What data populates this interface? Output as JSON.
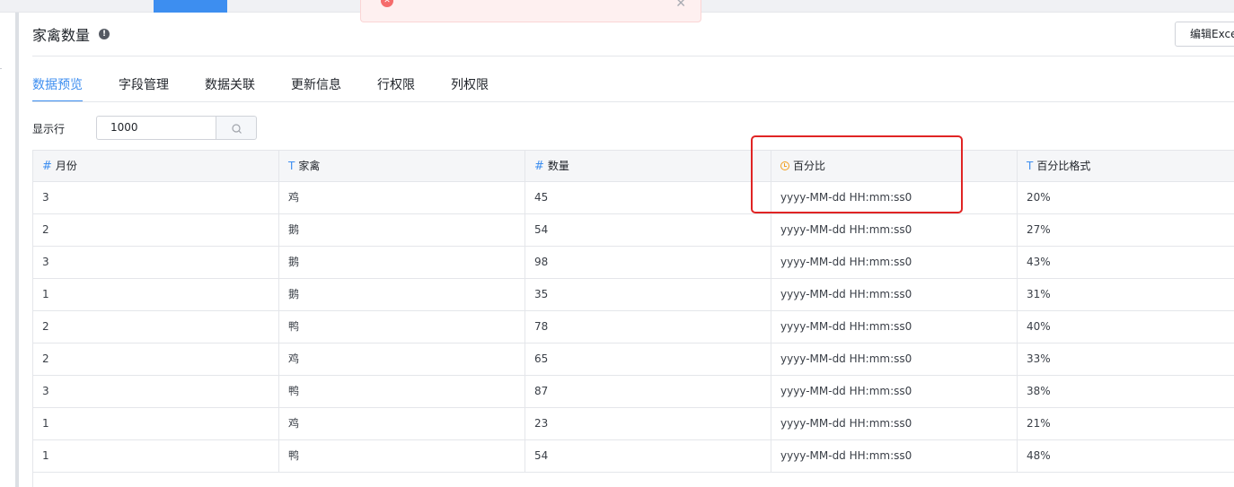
{
  "toast": {
    "error_icon": "error-circle-icon",
    "close_icon": "close-icon"
  },
  "title": "家禽数量",
  "info_icon": "info-icon",
  "actions": {
    "edit_excel": "编辑Excel"
  },
  "tabs": [
    {
      "label": "数据预览",
      "active": true
    },
    {
      "label": "字段管理",
      "active": false
    },
    {
      "label": "数据关联",
      "active": false
    },
    {
      "label": "更新信息",
      "active": false
    },
    {
      "label": "行权限",
      "active": false
    },
    {
      "label": "列权限",
      "active": false
    }
  ],
  "rows_control": {
    "label": "显示行",
    "value": "1000",
    "search_icon": "search-icon"
  },
  "colors": {
    "accent": "#3d8ef0",
    "highlight": "#e02424",
    "date_type": "#f0a020"
  },
  "table": {
    "columns": [
      {
        "type": "number",
        "type_glyph": "#",
        "name": "月份"
      },
      {
        "type": "text",
        "type_glyph": "T",
        "name": "家禽"
      },
      {
        "type": "number",
        "type_glyph": "#",
        "name": "数量"
      },
      {
        "type": "date",
        "type_glyph": "clock",
        "name": "百分比"
      },
      {
        "type": "text",
        "type_glyph": "T",
        "name": "百分比格式"
      }
    ],
    "rows": [
      [
        "3",
        "鸡",
        "45",
        "yyyy-MM-dd HH:mm:ss0",
        "20%"
      ],
      [
        "2",
        "鹅",
        "54",
        "yyyy-MM-dd HH:mm:ss0",
        "27%"
      ],
      [
        "3",
        "鹅",
        "98",
        "yyyy-MM-dd HH:mm:ss0",
        "43%"
      ],
      [
        "1",
        "鹅",
        "35",
        "yyyy-MM-dd HH:mm:ss0",
        "31%"
      ],
      [
        "2",
        "鸭",
        "78",
        "yyyy-MM-dd HH:mm:ss0",
        "40%"
      ],
      [
        "2",
        "鸡",
        "65",
        "yyyy-MM-dd HH:mm:ss0",
        "33%"
      ],
      [
        "3",
        "鸭",
        "87",
        "yyyy-MM-dd HH:mm:ss0",
        "38%"
      ],
      [
        "1",
        "鸡",
        "23",
        "yyyy-MM-dd HH:mm:ss0",
        "21%"
      ],
      [
        "1",
        "鸭",
        "54",
        "yyyy-MM-dd HH:mm:ss0",
        "48%"
      ]
    ]
  }
}
